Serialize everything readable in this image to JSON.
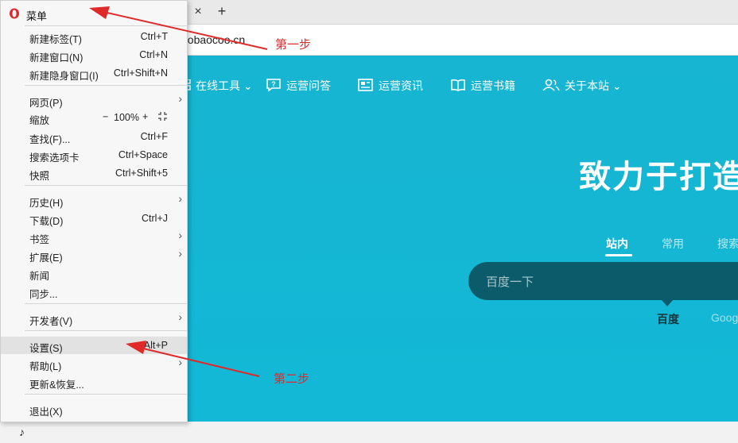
{
  "browser": {
    "tab_close": "×",
    "tab_new": "+",
    "url": "aobaocoo.cn"
  },
  "site": {
    "nav": [
      {
        "label": "在线工具 ⌄",
        "icon": "grid-icon"
      },
      {
        "label": "运营问答",
        "icon": "question-icon"
      },
      {
        "label": "运营资讯",
        "icon": "news-icon"
      },
      {
        "label": "运营书籍",
        "icon": "book-icon"
      },
      {
        "label": "关于本站 ⌄",
        "icon": "users-icon"
      }
    ],
    "headline": "致力于打造",
    "search_tabs": [
      "站内",
      "常用",
      "搜索"
    ],
    "search_placeholder": "百度一下",
    "engines": [
      "百度",
      "Goog"
    ]
  },
  "menu": {
    "title": "菜单",
    "items": {
      "new_tab": {
        "label": "新建标签(T)",
        "shortcut": "Ctrl+T"
      },
      "new_window": {
        "label": "新建窗口(N)",
        "shortcut": "Ctrl+N"
      },
      "new_private": {
        "label": "新建隐身窗口(I)",
        "shortcut": "Ctrl+Shift+N"
      },
      "page": {
        "label": "网页(P)"
      },
      "zoom": {
        "label": "缩放",
        "minus": "−",
        "value": "100%",
        "plus": "+"
      },
      "find": {
        "label": "查找(F)...",
        "shortcut": "Ctrl+F"
      },
      "search_tab": {
        "label": "搜索选项卡",
        "shortcut": "Ctrl+Space"
      },
      "snapshot": {
        "label": "快照",
        "shortcut": "Ctrl+Shift+5"
      },
      "history": {
        "label": "历史(H)"
      },
      "downloads": {
        "label": "下载(D)",
        "shortcut": "Ctrl+J"
      },
      "bookmarks": {
        "label": "书签"
      },
      "extensions": {
        "label": "扩展(E)"
      },
      "news": {
        "label": "新闻"
      },
      "sync": {
        "label": "同步..."
      },
      "developer": {
        "label": "开发者(V)"
      },
      "settings": {
        "label": "设置(S)",
        "shortcut": "Alt+P"
      },
      "help": {
        "label": "帮助(L)"
      },
      "update": {
        "label": "更新&恢复..."
      },
      "exit": {
        "label": "退出(X)"
      }
    }
  },
  "annotations": {
    "step1": "第一步",
    "step2": "第二步",
    "color": "#e02a2a"
  },
  "colors": {
    "site_bg": "#17b5d2",
    "search_bg": "#0b5b6a",
    "menu_bg": "#f7f7f7",
    "opera_red": "#e0262e"
  }
}
